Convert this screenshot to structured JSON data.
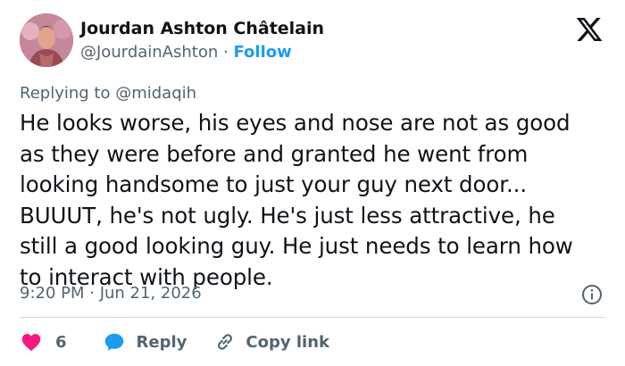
{
  "author": {
    "name": "Jourdan Ashton Châtelain",
    "handle": "@JourdainAshton",
    "separator": "·",
    "follow_label": "Follow"
  },
  "reply_context": {
    "prefix": "Replying to ",
    "mention": "@midaqih"
  },
  "tweet": {
    "text": "He looks worse, his eyes and nose are not as good\nas they were before and granted he went from\nlooking handsome to just your guy next door...\nBUUUT, he's not ugly. He's just less attractive, he\nstill a good looking guy. He just needs to learn how\nto interact with people.",
    "timestamp": "9:20 PM · Jun 21, 2026"
  },
  "actions": {
    "like_count": "6",
    "reply_label": "Reply",
    "copy_link_label": "Copy link"
  },
  "icons": {
    "brand": "x-logo-icon",
    "info": "info-icon",
    "like": "heart-icon",
    "reply": "speech-bubble-icon",
    "copy": "link-icon"
  },
  "colors": {
    "accent": "#1d9bf0",
    "heart": "#f91880",
    "muted": "#536471",
    "text": "#0f1419",
    "divider": "#cfd9de"
  }
}
